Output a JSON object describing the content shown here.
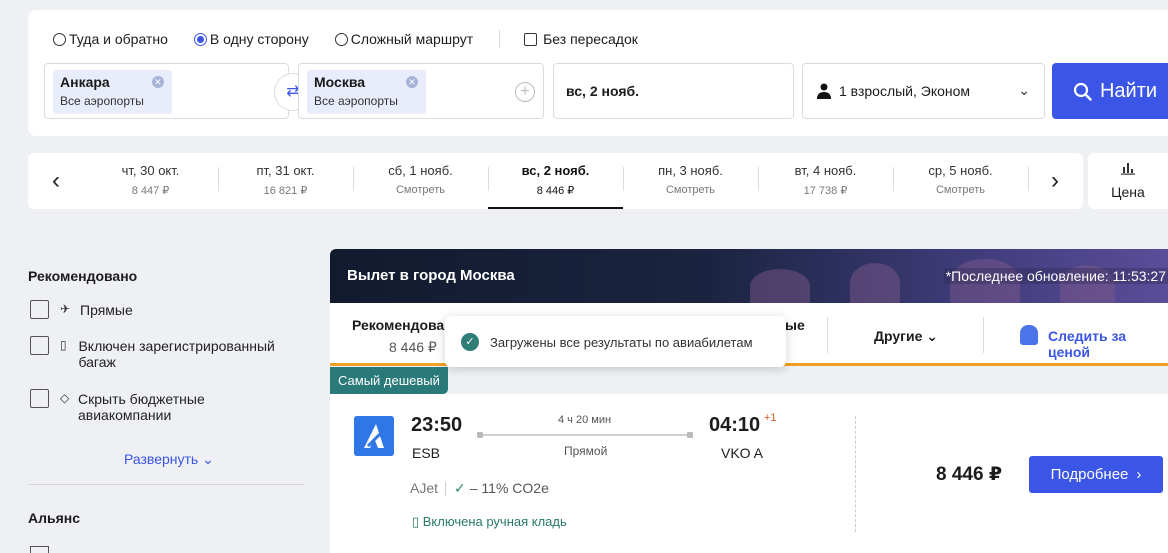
{
  "search": {
    "trip_types": [
      {
        "label": "Туда и обратно",
        "selected": false
      },
      {
        "label": "В одну сторону",
        "selected": true
      },
      {
        "label": "Сложный маршрут",
        "selected": false
      }
    ],
    "nonstop_label": "Без пересадок",
    "origin": {
      "city": "Анкара",
      "sub": "Все аэропорты"
    },
    "destination": {
      "city": "Москва",
      "sub": "Все аэропорты"
    },
    "date": "вс, 2 нояб.",
    "passengers": "1 взрослый, Эконом",
    "find_label": "Найти"
  },
  "date_strip": {
    "days": [
      {
        "date": "чт, 30 окт.",
        "price": "8 447 ₽",
        "active": false
      },
      {
        "date": "пт, 31 окт.",
        "price": "16 821 ₽",
        "active": false
      },
      {
        "date": "сб, 1 нояб.",
        "price": "Смотреть",
        "active": false
      },
      {
        "date": "вс, 2 нояб.",
        "price": "8 446 ₽",
        "active": true
      },
      {
        "date": "пн, 3 нояб.",
        "price": "Смотреть",
        "active": false
      },
      {
        "date": "вт, 4 нояб.",
        "price": "17 738 ₽",
        "active": false
      },
      {
        "date": "ср, 5 нояб.",
        "price": "Смотреть",
        "active": false
      }
    ],
    "price_sort_label": "Цена"
  },
  "filters": {
    "recommended_title": "Рекомендовано",
    "items": [
      {
        "label": "Прямые"
      },
      {
        "label": "Включен зарегистрированный багаж"
      },
      {
        "label": "Скрыть бюджетные авиакомпании"
      }
    ],
    "expand_label": "Развернуть",
    "alliance_title": "Альянс"
  },
  "results": {
    "banner_title": "Вылет в город Москва",
    "last_update": "*Последнее обновление: 11:53:27",
    "tabs": {
      "recommended": "Рекомендовано",
      "recommended_price": "8 446 ₽",
      "partial": "ые",
      "other": "Другие",
      "track": "Следить за ценой"
    },
    "toast": "Загружены все результаты по авиабилетам",
    "cheapest_badge": "Самый дешевый",
    "flight": {
      "dep_time": "23:50",
      "dep_airport": "ESB",
      "duration": "4 ч 20 мин",
      "stops": "Прямой",
      "arr_time": "04:10",
      "arr_day_offset": "+1",
      "arr_airport": "VKO A",
      "airline": "AJet",
      "co2": "– 11% CO2e",
      "baggage": "Включена ручная кладь",
      "price": "8 446 ₽",
      "details_label": "Подробнее"
    }
  },
  "colors": {
    "accent": "#3b55e6",
    "badge": "#2b7a7a",
    "tab_underline": "#f2a127"
  }
}
